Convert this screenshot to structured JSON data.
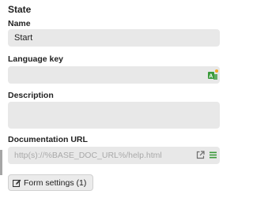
{
  "section": {
    "title": "State"
  },
  "fields": {
    "name": {
      "label": "Name",
      "value": "Start"
    },
    "language_key": {
      "label": "Language key",
      "value": "",
      "icon": "translate-icon"
    },
    "description": {
      "label": "Description",
      "value": ""
    },
    "documentation_url": {
      "label": "Documentation URL",
      "placeholder": "http(s)://%BASE_DOC_URL%/help.html",
      "icons": [
        "external-link-icon",
        "menu-icon"
      ]
    }
  },
  "actions": {
    "form_settings": {
      "label": "Form settings (1)",
      "icon": "edit-icon"
    }
  },
  "colors": {
    "field_bg": "#e8e8e8",
    "placeholder": "#a9a9a9",
    "icon_green": "#3a9a3a"
  }
}
